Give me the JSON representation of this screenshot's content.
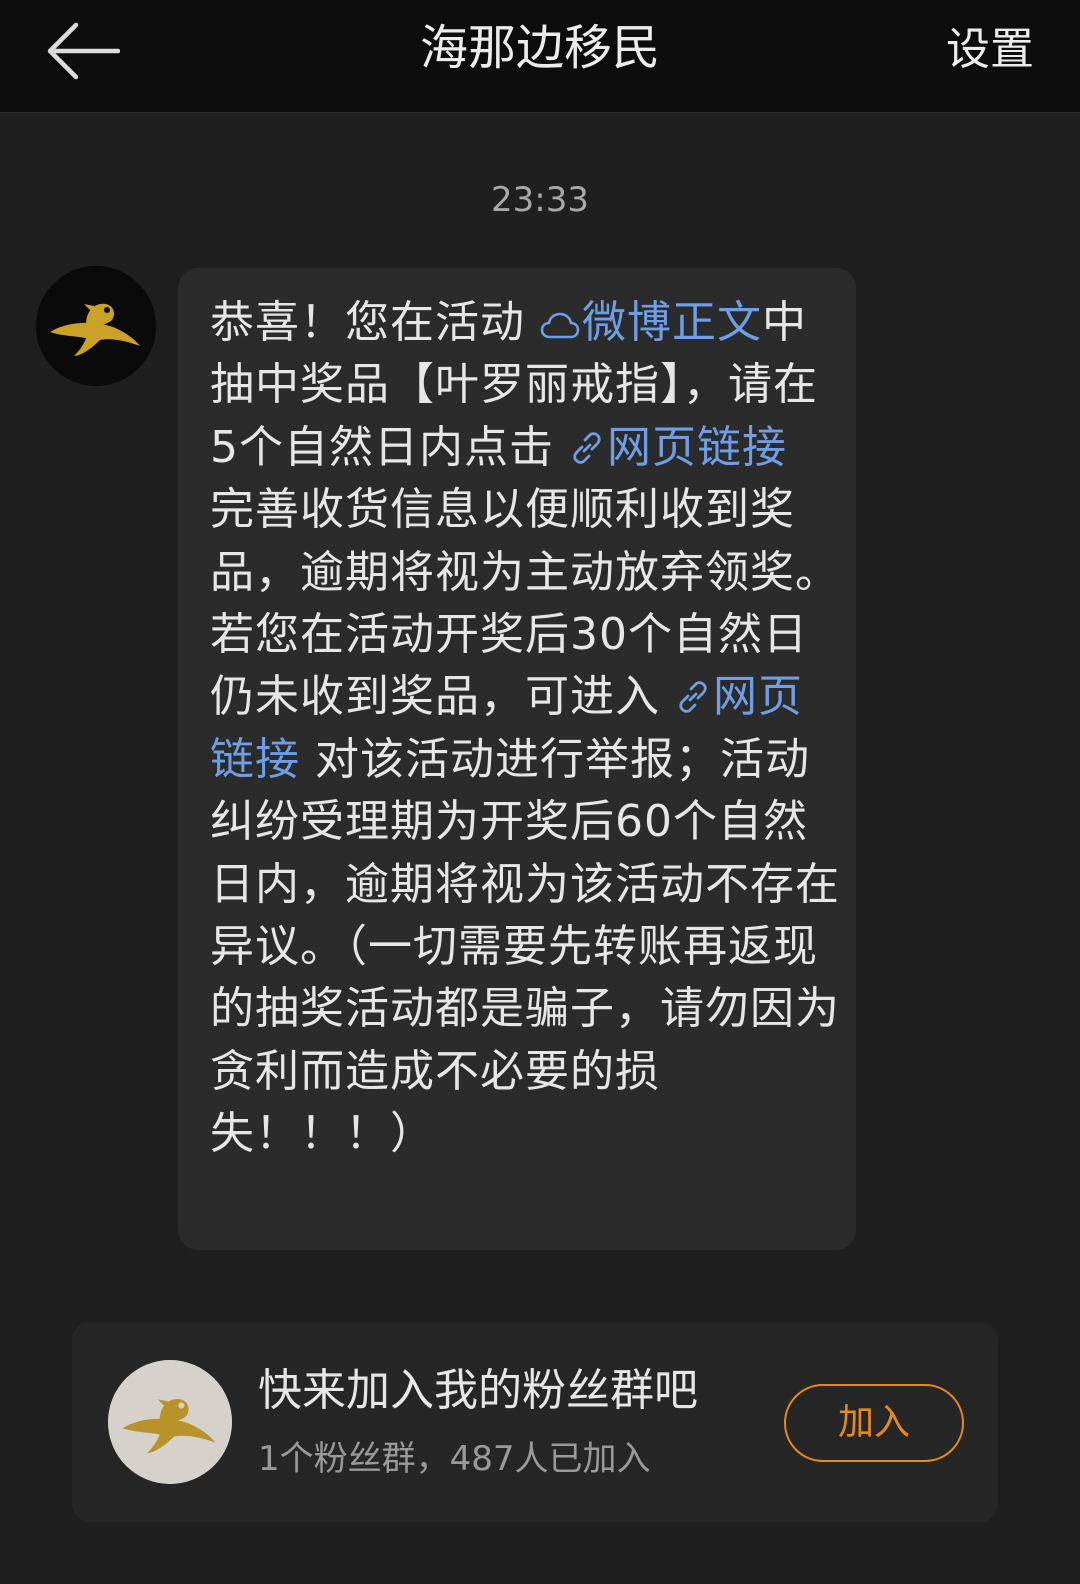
{
  "header": {
    "back_icon": "arrow-left-icon",
    "title": "海那边移民",
    "settings_label": "设置"
  },
  "chat": {
    "timestamp": "23:33",
    "message": {
      "t1": "恭喜！您在活动 ",
      "link1": "微博正文",
      "link1_icon": "cloud-icon",
      "t2": "中抽中奖品【叶罗丽戒指】，请在5个自然日内点击 ",
      "link2": "网页链接",
      "link2_icon": "link-icon",
      "t3": " 完善收货信息以便顺利收到奖品，逾期将视为主动放弃领奖。若您在活动开奖后30个自然日仍未收到奖品，可进入 ",
      "link3": "网页链接",
      "link3_icon": "link-icon",
      "t4": " 对该活动进行举报；活动纠纷受理期为开奖后60个自然日内，逾期将视为该活动不存在异议。（一切需要先转账再返现的抽奖活动都是骗子，请勿因为贪利而造成不必要的损失！！！）"
    }
  },
  "fan_group": {
    "title": "快来加入我的粉丝群吧",
    "subtitle": "1个粉丝群，487人已加入",
    "join_label": "加入"
  },
  "colors": {
    "link": "#6d9ee6",
    "accent": "#e78a1e",
    "bird": "#c9a227"
  }
}
